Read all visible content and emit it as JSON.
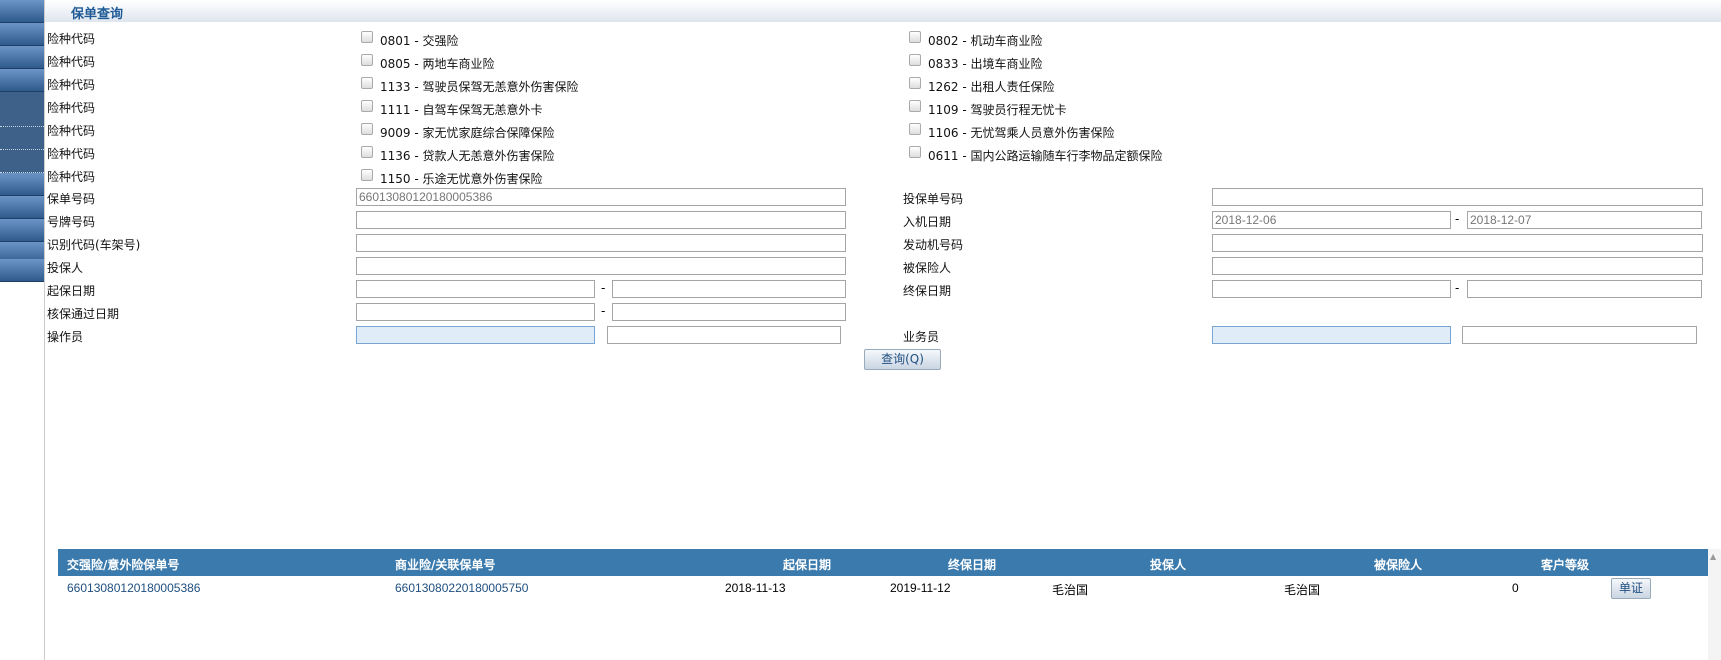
{
  "header": {
    "title": "保单查询"
  },
  "risk_label": "险种代码",
  "risks": [
    [
      "0801 - 交强险",
      "0802 - 机动车商业险"
    ],
    [
      "0805 - 两地车商业险",
      "0833 - 出境车商业险"
    ],
    [
      "1133 - 驾驶员保驾无恙意外伤害保险",
      "1262 - 出租人责任保险"
    ],
    [
      "1111 - 自驾车保驾无恙意外卡",
      "1109 - 驾驶员行程无忧卡"
    ],
    [
      "9009 - 家无忧家庭综合保障保险",
      "1106 - 无忧驾乘人员意外伤害保险"
    ],
    [
      "1136 - 贷款人无恙意外伤害保险",
      "0611 - 国内公路运输随车行李物品定额保险"
    ],
    [
      "1150 - 乐途无忧意外伤害保险"
    ]
  ],
  "form": {
    "policy_no": {
      "label": "保单号码",
      "value": "66013080120180005386"
    },
    "proposal_no": {
      "label": "投保单号码",
      "value": ""
    },
    "plate_no": {
      "label": "号牌号码",
      "value": ""
    },
    "entry_date": {
      "label": "入机日期",
      "from": "2018-12-06",
      "to": "2018-12-07"
    },
    "vin": {
      "label": "识别代码(车架号)",
      "value": ""
    },
    "engine_no": {
      "label": "发动机号码",
      "value": ""
    },
    "applicant": {
      "label": "投保人",
      "value": ""
    },
    "insured": {
      "label": "被保险人",
      "value": ""
    },
    "start_date": {
      "label": "起保日期"
    },
    "end_date": {
      "label": "终保日期"
    },
    "approve_date": {
      "label": "核保通过日期"
    },
    "operator": {
      "label": "操作员"
    },
    "salesman": {
      "label": "业务员"
    },
    "dash": "-",
    "query_button": "查询(Q)"
  },
  "table": {
    "headers": [
      "交强险/意外险保单号",
      "商业险/关联保单号",
      "起保日期",
      "终保日期",
      "投保人",
      "被保险人",
      "客户等级"
    ],
    "rows": [
      {
        "c0": "66013080120180005386",
        "c1": "66013080220180005750",
        "c2": "2018-11-13",
        "c3": "2019-11-12",
        "c4": "毛治国",
        "c5": "毛治国",
        "c6": "0",
        "button": "单证"
      }
    ]
  },
  "colors": {
    "accent": "#3a7aad",
    "title": "#1f5b97"
  }
}
